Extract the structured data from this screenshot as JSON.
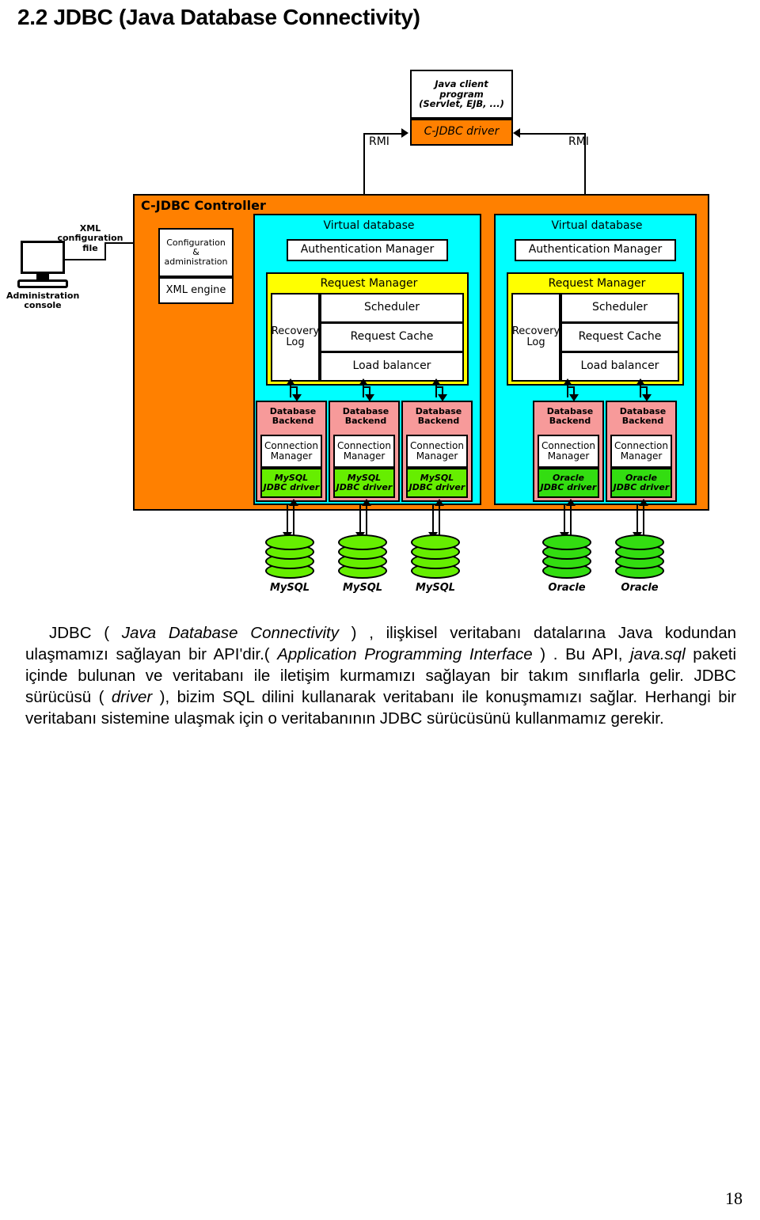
{
  "heading": "2.2 JDBC (Java Database Connectivity)",
  "figure": {
    "client_box": {
      "line1": "Java client",
      "line2": "program",
      "line3": "(Servlet, EJB, ...)"
    },
    "driver_box": "C-JDBC driver",
    "rmi_left": "RMI",
    "rmi_right": "RMI",
    "controller_title": "C-JDBC Controller",
    "xml_config_label": {
      "line1": "XML",
      "line2": "configuration",
      "line3": "file"
    },
    "console_label": {
      "line1": "Administration",
      "line2": "console"
    },
    "config_admin": {
      "line1": "Configuration",
      "line2": "&",
      "line3": "administration"
    },
    "xml_engine": "XML engine",
    "virtual_databases": [
      {
        "title": "Virtual database",
        "auth_manager": "Authentication Manager",
        "request_manager": {
          "title": "Request Manager",
          "recovery_log": {
            "line1": "Recovery",
            "line2": "Log"
          },
          "scheduler": "Scheduler",
          "request_cache": "Request Cache",
          "load_balancer": "Load balancer"
        },
        "backends": [
          {
            "title1": "Database",
            "title2": "Backend",
            "conn1": "Connection",
            "conn2": "Manager",
            "drv1": "MySQL",
            "drv2": "JDBC driver"
          },
          {
            "title1": "Database",
            "title2": "Backend",
            "conn1": "Connection",
            "conn2": "Manager",
            "drv1": "MySQL",
            "drv2": "JDBC driver"
          },
          {
            "title1": "Database",
            "title2": "Backend",
            "conn1": "Connection",
            "conn2": "Manager",
            "drv1": "MySQL",
            "drv2": "JDBC driver"
          }
        ]
      },
      {
        "title": "Virtual database",
        "auth_manager": "Authentication Manager",
        "request_manager": {
          "title": "Request Manager",
          "recovery_log": {
            "line1": "Recovery",
            "line2": "Log"
          },
          "scheduler": "Scheduler",
          "request_cache": "Request Cache",
          "load_balancer": "Load balancer"
        },
        "backends": [
          {
            "title1": "Database",
            "title2": "Backend",
            "conn1": "Connection",
            "conn2": "Manager",
            "drv1": "Oracle",
            "drv2": "JDBC driver"
          },
          {
            "title1": "Database",
            "title2": "Backend",
            "conn1": "Connection",
            "conn2": "Manager",
            "drv1": "Oracle",
            "drv2": "JDBC driver"
          }
        ]
      }
    ],
    "databases": [
      {
        "label": "MySQL",
        "color": "#66EE00"
      },
      {
        "label": "MySQL",
        "color": "#66EE00"
      },
      {
        "label": "MySQL",
        "color": "#66EE00"
      },
      {
        "label": "Oracle",
        "color": "#33DD11"
      },
      {
        "label": "Oracle",
        "color": "#33DD11"
      }
    ],
    "colors": {
      "controller": "#FF8000",
      "virtual_database": "#00FFFF",
      "request_manager": "#FFFF00",
      "backend": "#F79A9A",
      "driver_mysql": "#66EE00",
      "driver_oracle": "#33DD11"
    }
  },
  "body": {
    "p1_a": "JDBC ( ",
    "p1_i1": "Java Database Connectivity",
    "p1_b": " ) , ilişkisel veritabanı datalarına Java kodundan ulaşmamızı sağlayan bir API'dir.( ",
    "p1_i2": "Application Programming Interface",
    "p1_c": " ) . Bu API, ",
    "p1_i3": "java.sql",
    "p1_d": " paketi içinde bulunan ve veritabanı ile iletişim kurmamızı sağlayan bir takım sınıflarla gelir. JDBC sürücüsü ( ",
    "p1_i4": "driver",
    "p1_e": " ), bizim SQL dilini kullanarak veritabanı ile konuşmamızı sağlar. Herhangi bir veritabanı sistemine ulaşmak için o veritabanının JDBC sürücüsünü kullanmamız gerekir."
  },
  "page_number": "18"
}
